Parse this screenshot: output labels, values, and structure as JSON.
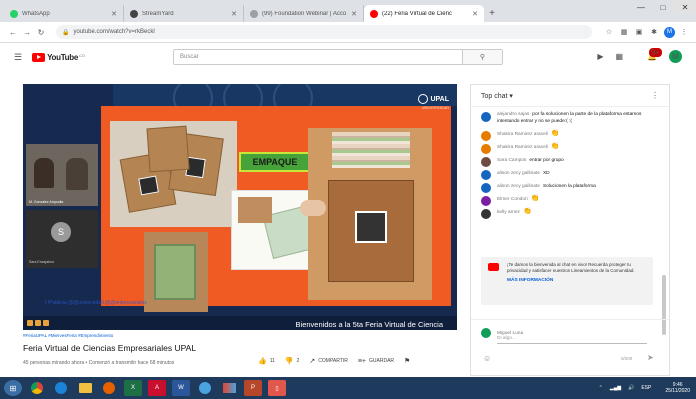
{
  "browser": {
    "tabs": [
      {
        "label": "WhatsApp",
        "color": "#25d366"
      },
      {
        "label": "StreamYard",
        "color": "#444444"
      },
      {
        "label": "(99) Foundation Webinar | Acco",
        "color": "#9aa0a6"
      },
      {
        "label": "(22) Feria Virtual de Cienc",
        "color": "#ff0000",
        "active": true
      }
    ],
    "new_tab": "+",
    "url": "youtube.com/watch?v=rkBeckl",
    "win_min": "—",
    "win_max": "□",
    "win_close": "✕",
    "profile_initial": "M"
  },
  "youtube": {
    "logo_word": "YouTube",
    "logo_cc": "CO",
    "search_placeholder": "Buscar",
    "notif_count": "9+",
    "avatar_initial": "M"
  },
  "video": {
    "org": "UPAL",
    "org_sub": "UNIVERSIDAD",
    "empaque_label": "EMPAQUE",
    "participant_initial": "S",
    "cam1_caption": "M. Gonzalez Ampudia",
    "cam2_caption": "Sara Encajatoro",
    "social": "f /Publicia   @@universidad   @@empresariales",
    "banner": "Bienvenidos a la 5ta Feria Virtual de Ciencia"
  },
  "info": {
    "hashtags": "#FeriaUPAL #MiervesFeria #Emprendimiento",
    "title": "Feria Virtual de Ciencias Empresariales UPAL",
    "meta": "45 personas mirando ahora • Comenzó a transmitir hace 68 minutos",
    "likes": "11",
    "dislikes": "2",
    "share": "COMPARTIR",
    "save": "GUARDAR"
  },
  "chat": {
    "header": "Top chat",
    "messages": [
      {
        "author": "alejandro sajas",
        "text": "por fa solucionen la parte de la plataforma estamos intentando entrar y no se puede:( :(",
        "color": "#1565c0",
        "emoji": ""
      },
      {
        "author": "Shakira Ramirez araceli",
        "text": "",
        "color": "#e67c00",
        "emoji": "👏"
      },
      {
        "author": "Shakira Ramirez araceli",
        "text": "",
        "color": "#e67c00",
        "emoji": "👏"
      },
      {
        "author": "Sara Campos",
        "text": "entrar por grupo",
        "color": "#6d4c41",
        "emoji": ""
      },
      {
        "author": "alison zecy gallinate",
        "text": "XD",
        "color": "#1565c0",
        "emoji": ""
      },
      {
        "author": "alison zecy gallinate",
        "text": "Solucionen la plataforma",
        "color": "#1565c0",
        "emoji": ""
      },
      {
        "author": "Elmer Condori",
        "text": "",
        "color": "#7b1fa2",
        "emoji": "👏"
      },
      {
        "author": "kelly arnez",
        "text": "",
        "color": "#333333",
        "emoji": "👏"
      }
    ],
    "notice": "¡Te damos la bienvenida al chat en vivo! Recuerda proteger tu privacidad y satisfacer nuestros Lineamientos de la Comunidad.",
    "notice_more": "MÁS INFORMACIÓN",
    "user": "Miguel Luna",
    "input_placeholder": "Di algo...",
    "counter": "0/200",
    "send": "➤"
  },
  "taskbar": {
    "time": "9:46",
    "date": "25/11/2020",
    "lang": "ESP"
  }
}
